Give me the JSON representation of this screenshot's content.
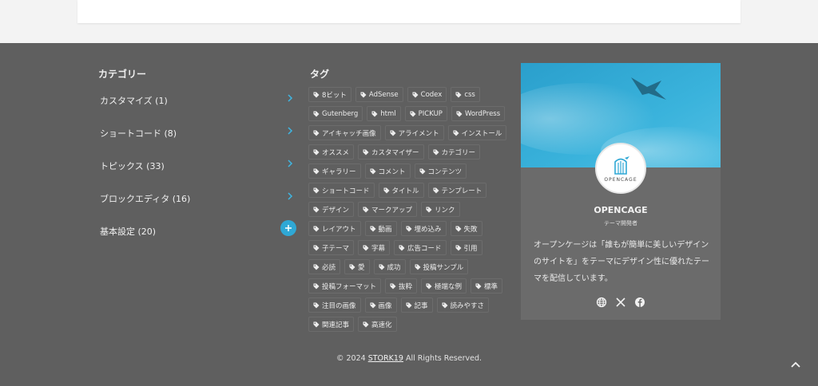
{
  "categories": {
    "title": "カテゴリー",
    "items": [
      {
        "label": "カスタマイズ (1)"
      },
      {
        "label": "ショートコード (8)"
      },
      {
        "label": "トピックス (33)"
      },
      {
        "label": "ブロックエディタ (16)"
      },
      {
        "label": "基本設定 (20)"
      }
    ]
  },
  "tags": {
    "title": "タグ",
    "items": [
      "8ビット",
      "AdSense",
      "Codex",
      "css",
      "Gutenberg",
      "html",
      "PICKUP",
      "WordPress",
      "アイキャッチ画像",
      "アライメント",
      "インストール",
      "オススメ",
      "カスタマイザー",
      "カテゴリー",
      "ギャラリー",
      "コメント",
      "コンテンツ",
      "ショートコード",
      "タイトル",
      "テンプレート",
      "デザイン",
      "マークアップ",
      "リンク",
      "レイアウト",
      "動画",
      "埋め込み",
      "失敗",
      "子テーマ",
      "字幕",
      "広告コード",
      "引用",
      "必読",
      "愛",
      "成功",
      "投稿サンプル",
      "投稿フォーマット",
      "抜粋",
      "極端な例",
      "標準",
      "注目の画像",
      "画像",
      "記事",
      "読みやすさ",
      "関連記事",
      "高速化"
    ]
  },
  "profile": {
    "logo_text": "OPENCAGE",
    "name": "OPENCAGE",
    "role": "テーマ開発者",
    "description": "オープンケージは「誰もが簡単に美しいデザインのサイトを」をテーマにデザイン性に優れたテーマを配信しています。",
    "icons": [
      "globe-icon",
      "x-icon",
      "facebook-icon"
    ]
  },
  "footer": {
    "copyright_prefix": "© 2024",
    "site_link": "STORK19",
    "copyright_suffix": "All Rights Reserved."
  },
  "colors": {
    "footer_bg": "#5f5f5f",
    "accent": "#3fb6e3",
    "page_bg": "#f3f3f3"
  }
}
